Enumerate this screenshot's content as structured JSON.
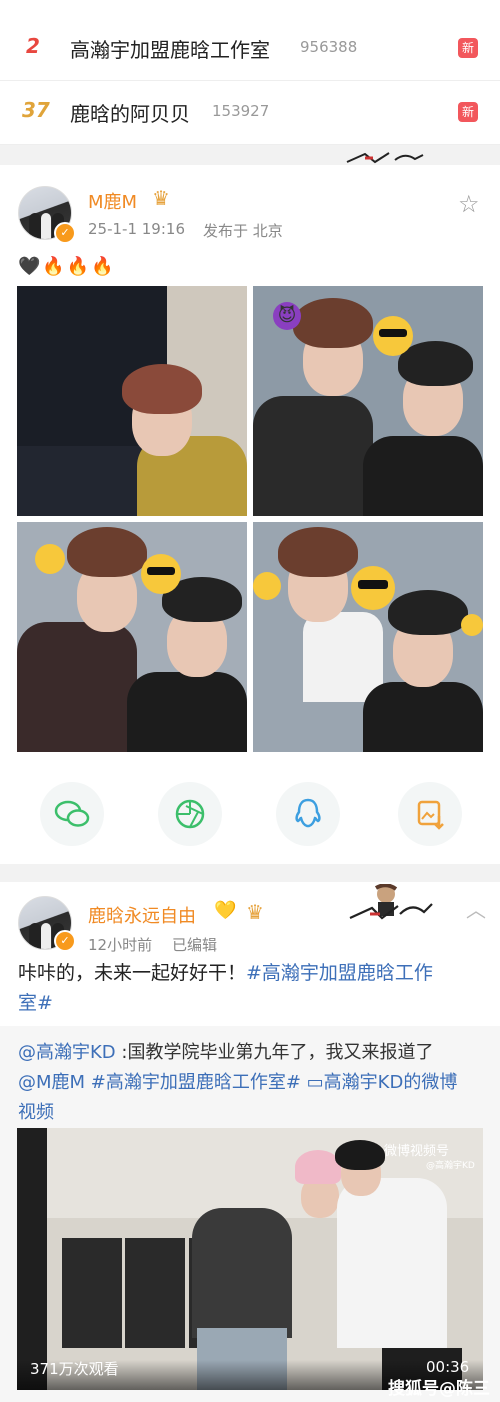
{
  "hot_list": [
    {
      "rank": "2",
      "title": "高瀚宇加盟鹿晗工作室",
      "count": "956388",
      "badge": "新",
      "rank_color": "#e8473f"
    },
    {
      "rank": "37",
      "title": "鹿晗的阿贝贝",
      "count": "153927",
      "badge": "新",
      "rank_color": "#e0a43a"
    }
  ],
  "post1": {
    "username": "M鹿M",
    "crown": "♛",
    "verify": "✓",
    "time": "25-1-1 19:16",
    "location": "发布于 北京",
    "emoji_line": [
      "🖤",
      "🔥",
      "🔥",
      "🔥"
    ],
    "star_icon": "☆",
    "emoji_stickers": [
      "😈",
      "😎",
      "😂",
      "😎",
      "😂",
      "😎",
      "😂"
    ]
  },
  "share_icons": [
    "wechat-icon",
    "moments-icon",
    "qq-icon",
    "save-image-icon"
  ],
  "post2": {
    "username": "鹿晗永远自由",
    "heart": "💛",
    "crown": "♛",
    "verify": "✓",
    "time": "12小时前",
    "edited": "已编辑",
    "text_plain": "咔咔的，未来一起好好干！",
    "text_tag_a": "#高瀚宇加盟鹿晗工作",
    "text_tag_b": "室#",
    "repost_mention": "@高瀚宇KD",
    "repost_text": " :国教学院毕业第九年了，我又来报道了",
    "repost_mention2": "@M鹿M",
    "repost_tag": " #高瀚宇加盟鹿晗工作室#",
    "repost_video_link": " ▭高瀚宇KD的微博",
    "repost_video_link2": "视频",
    "video_views": "371万次观看",
    "video_duration": "00:36",
    "video_watermark": "微博视频号",
    "video_watermark_sub": "@高瀚宇KD",
    "chevron": "︿"
  },
  "footer_watermark": "搜狐号@陈三"
}
